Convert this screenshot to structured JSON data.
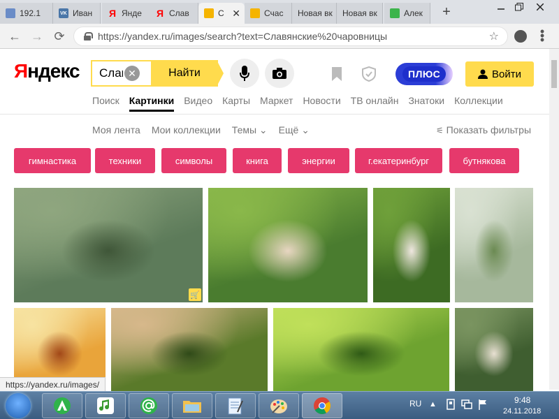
{
  "browser": {
    "tabs": [
      {
        "title": "192.1",
        "icon": "doc-icon",
        "color": "#6a8cc7"
      },
      {
        "title": "Иван",
        "icon": "vk-icon",
        "color": "#4a76a8"
      },
      {
        "title": "Янде",
        "icon": "yandex-icon",
        "color": "#ff0000"
      },
      {
        "title": "Слав",
        "icon": "yandex-icon",
        "color": "#ff0000"
      },
      {
        "title": "С",
        "icon": "images-icon",
        "color": "#f5b400",
        "active": true
      },
      {
        "title": "Счас",
        "icon": "images-icon",
        "color": "#f5b400"
      },
      {
        "title": "Новая вк",
        "icon": "none"
      },
      {
        "title": "Новая вк",
        "icon": "none"
      },
      {
        "title": "Алек",
        "icon": "sheet-icon",
        "color": "#3cb44b"
      }
    ],
    "new_tab": "+",
    "url": "https://yandex.ru/images/search?text=Славянские%20чаровницы",
    "status_url": "https://yandex.ru/images/"
  },
  "header": {
    "logo_red": "Я",
    "logo_black": "ндекс",
    "search_value": "Слав",
    "find_label": "Найти",
    "plus_label": "ПЛЮС",
    "login_label": "Войти"
  },
  "services": [
    "Поиск",
    "Картинки",
    "Видео",
    "Карты",
    "Маркет",
    "Новости",
    "ТВ онлайн",
    "Знатоки",
    "Коллекции"
  ],
  "services_active": "Картинки",
  "subnav": [
    "Моя лента",
    "Мои коллекции",
    "Темы ⌄",
    "Ещё ⌄"
  ],
  "filters_label": "Показать фильтры",
  "tags": [
    "гимнастика",
    "техники",
    "символы",
    "книга",
    "энергии",
    "г.екатеринбург",
    "бутнякова"
  ],
  "images": [
    {
      "alt": "painting of maidens by river",
      "colors": [
        "#5d7b5a",
        "#8fa67f",
        "#3f5638"
      ]
    },
    {
      "alt": "girl hugging birch tree",
      "colors": [
        "#4a7c2f",
        "#8ab84a",
        "#e8d6c2"
      ]
    },
    {
      "alt": "girl sitting on grass in folk dress",
      "colors": [
        "#3d6b23",
        "#6fa03a",
        "#efe7e0"
      ]
    },
    {
      "alt": "woman holding pot",
      "colors": [
        "#a6b89c",
        "#d9e1d2",
        "#6b8a52"
      ]
    },
    {
      "alt": "fantasy golden woman",
      "colors": [
        "#e9a43a",
        "#f7e3a1",
        "#a24818"
      ]
    },
    {
      "alt": "woman with flower wreath",
      "colors": [
        "#5a7a2a",
        "#d7b88b",
        "#2f4a18"
      ]
    },
    {
      "alt": "girl in red skirt in sunlit meadow",
      "colors": [
        "#6ea330",
        "#c0e05a",
        "#2f5a16"
      ]
    },
    {
      "alt": "red-haired woman in forest",
      "colors": [
        "#3f5e30",
        "#7a9460",
        "#e8e0d2"
      ]
    }
  ],
  "taskbar": {
    "lang": "RU",
    "time": "9:48",
    "date": "24.11.2018"
  }
}
